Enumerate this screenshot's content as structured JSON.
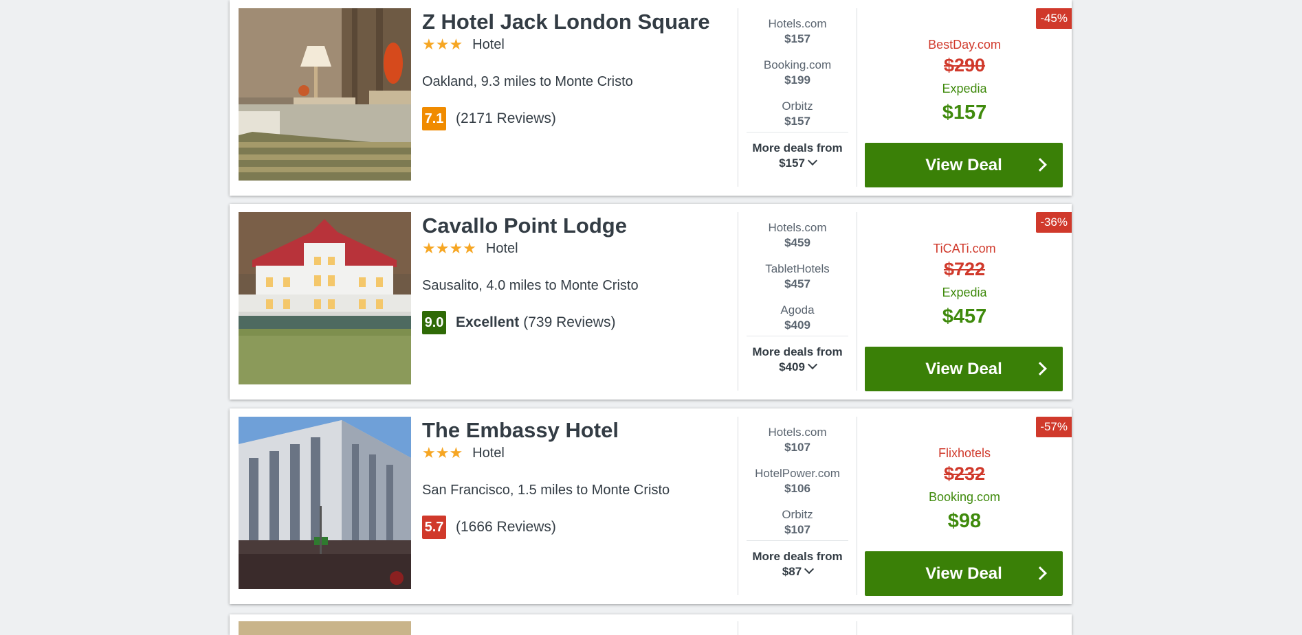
{
  "hotels": [
    {
      "name": "Z Hotel Jack London Square",
      "stars": "★★★",
      "type": "Hotel",
      "location": "Oakland, 9.3 miles to Monte Cristo",
      "score": "7.1",
      "score_color": "#f08b00",
      "rating_word": "",
      "reviews": "(2171 Reviews)",
      "providers": [
        {
          "name": "Hotels.com",
          "price": "$157"
        },
        {
          "name": "Booking.com",
          "price": "$199"
        },
        {
          "name": "Orbitz",
          "price": "$157"
        }
      ],
      "more_deals_label": "More deals from",
      "more_deals_price": "$157",
      "discount": "-45%",
      "old_source": "BestDay.com",
      "old_price": "$290",
      "new_source": "Expedia",
      "new_price": "$157",
      "view_deal": "View Deal",
      "photo": "bedroom-photo"
    },
    {
      "name": "Cavallo Point Lodge",
      "stars": "★★★★",
      "type": "Hotel",
      "location": "Sausalito, 4.0 miles to Monte Cristo",
      "score": "9.0",
      "score_color": "#2f6a06",
      "rating_word": "Excellent",
      "reviews": "(739 Reviews)",
      "providers": [
        {
          "name": "Hotels.com",
          "price": "$459"
        },
        {
          "name": "TabletHotels",
          "price": "$457"
        },
        {
          "name": "Agoda",
          "price": "$409"
        }
      ],
      "more_deals_label": "More deals from",
      "more_deals_price": "$409",
      "discount": "-36%",
      "old_source": "TiCATi.com",
      "old_price": "$722",
      "new_source": "Expedia",
      "new_price": "$457",
      "view_deal": "View Deal",
      "photo": "lodge-photo"
    },
    {
      "name": "The Embassy Hotel",
      "stars": "★★★",
      "type": "Hotel",
      "location": "San Francisco, 1.5 miles to Monte Cristo",
      "score": "5.7",
      "score_color": "#d0392b",
      "rating_word": "",
      "reviews": "(1666 Reviews)",
      "providers": [
        {
          "name": "Hotels.com",
          "price": "$107"
        },
        {
          "name": "HotelPower.com",
          "price": "$106"
        },
        {
          "name": "Orbitz",
          "price": "$107"
        }
      ],
      "more_deals_label": "More deals from",
      "more_deals_price": "$87",
      "discount": "-57%",
      "old_source": "Flixhotels",
      "old_price": "$232",
      "new_source": "Booking.com",
      "new_price": "$98",
      "view_deal": "View Deal",
      "photo": "building-photo"
    }
  ]
}
